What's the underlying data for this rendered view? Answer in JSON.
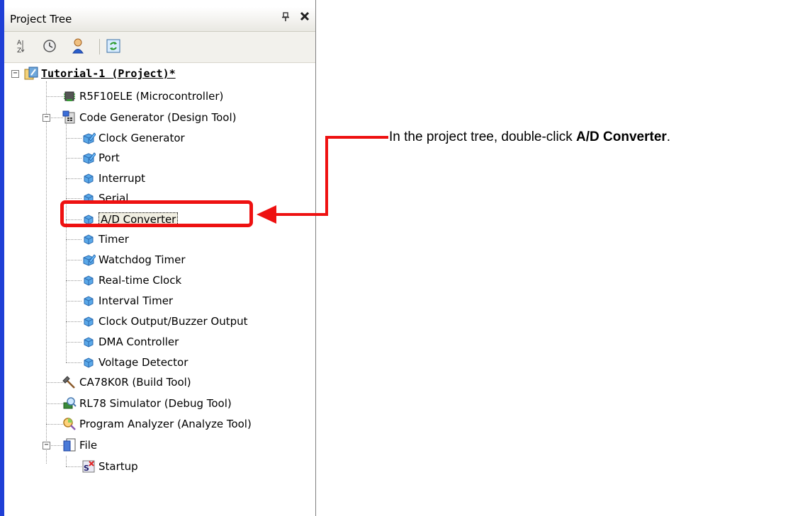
{
  "panel": {
    "title": "Project Tree",
    "pin_glyph": "ᵩ",
    "close_glyph": "✕"
  },
  "toolbar": {
    "buttons": [
      {
        "icon": "sort-icon"
      },
      {
        "icon": "clock-icon"
      },
      {
        "icon": "person-icon"
      },
      {
        "icon": "refresh-icon"
      }
    ]
  },
  "tree": {
    "root_label": "Tutorial-1 (Project)*",
    "items": [
      {
        "label": "R5F10ELE (Microcontroller)",
        "icon": "chip-icon"
      },
      {
        "label": "Code Generator (Design Tool)",
        "icon": "code-generator-icon"
      },
      {
        "label": "Clock Generator",
        "icon": "cube-edit-icon"
      },
      {
        "label": "Port",
        "icon": "cube-edit-icon"
      },
      {
        "label": "Interrupt",
        "icon": "cube-icon"
      },
      {
        "label": "Serial",
        "icon": "cube-icon"
      },
      {
        "label": "A/D Converter",
        "icon": "cube-icon"
      },
      {
        "label": "Timer",
        "icon": "cube-icon"
      },
      {
        "label": "Watchdog Timer",
        "icon": "cube-edit-icon"
      },
      {
        "label": "Real-time Clock",
        "icon": "cube-icon"
      },
      {
        "label": "Interval Timer",
        "icon": "cube-icon"
      },
      {
        "label": "Clock Output/Buzzer Output",
        "icon": "cube-icon"
      },
      {
        "label": "DMA Controller",
        "icon": "cube-icon"
      },
      {
        "label": "Voltage Detector",
        "icon": "cube-icon"
      },
      {
        "label": "CA78K0R (Build Tool)",
        "icon": "hammer-icon"
      },
      {
        "label": "RL78 Simulator (Debug Tool)",
        "icon": "simulator-icon"
      },
      {
        "label": "Program Analyzer (Analyze Tool)",
        "icon": "analyzer-icon"
      },
      {
        "label": "File",
        "icon": "file-folder-icon"
      },
      {
        "label": "Startup",
        "icon": "startup-file-icon"
      }
    ]
  },
  "annotation": {
    "prefix": "In the project tree, double-click ",
    "bold": "A/D Converter",
    "suffix": "."
  },
  "colors": {
    "callout": "#ee1111",
    "accent_bar": "#1f3fd6"
  }
}
